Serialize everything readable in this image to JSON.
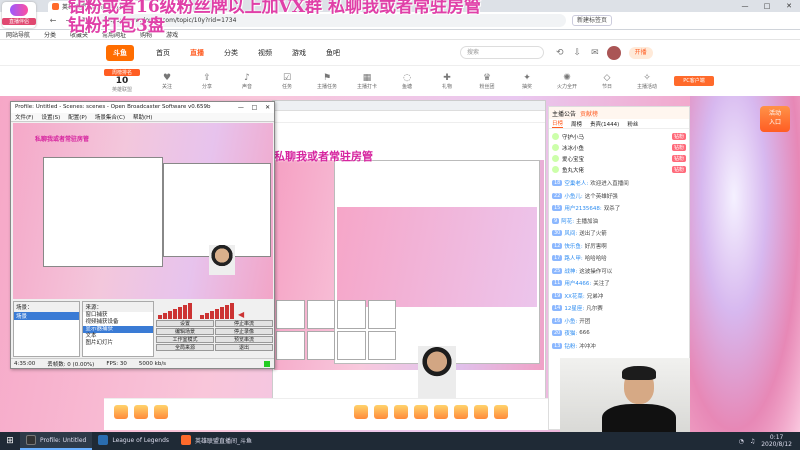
{
  "browser": {
    "tab_title": "英雄联盟直播间_斗鱼直播",
    "url": "https://www.douyu.com/topic/10y?rid=1734",
    "nav_back": "←",
    "nav_forward": "→",
    "nav_reload": "↻",
    "ext_label": "新建标签页",
    "window_min": "—",
    "window_max": "□",
    "window_close": "✕",
    "bookmarks": [
      "网站导航",
      "分类",
      "收藏夹",
      "常用网址",
      "购物",
      "游戏"
    ]
  },
  "overlay": {
    "app_label": "直播伴侣",
    "headline": "钻粉或者16级粉丝牌以上加VX群 私聊我或者常驻房管 钻粉打包3盘",
    "stream_headline": "私聊我或者常驻房管"
  },
  "site": {
    "logo": "斗鱼",
    "nav": [
      "首页",
      "直播",
      "分类",
      "视频",
      "游戏",
      "鱼吧"
    ],
    "nav_active": "直播",
    "search_placeholder": "搜索",
    "open_btn": "开播"
  },
  "room": {
    "rank_tag": "周榜排名",
    "rank_num": "10",
    "rank_sub": "英雄联盟",
    "tools": [
      "关注",
      "分享",
      "声音",
      "任务",
      "主播任务",
      "主播打卡",
      "鱼塘",
      "礼物",
      "粉丝团",
      "抽奖",
      "火力全开",
      "节日",
      "主播活动"
    ],
    "pc_btn": "PC客户端"
  },
  "chat": {
    "top_label": "主播公告",
    "top_tag": "贡献榜",
    "tabs": [
      "日榜",
      "周榜",
      "贵宾(1444)",
      "粉丝"
    ],
    "tab_active": "日榜",
    "ranks": [
      {
        "name": "守护小马",
        "badge": "钻粉"
      },
      {
        "name": "冰冰小鱼",
        "badge": "钻粉"
      },
      {
        "name": "爱心宝宝",
        "badge": "钻粉"
      },
      {
        "name": "鱼丸大佬",
        "badge": "钻粉"
      }
    ],
    "messages": [
      {
        "lv": "18",
        "user": "空巢老人:",
        "text": "欢迎进入直播间"
      },
      {
        "lv": "22",
        "user": "小鱼儿:",
        "text": "这个英雄好强"
      },
      {
        "lv": "15",
        "user": "用户2135648:",
        "text": "双杀了"
      },
      {
        "lv": "9",
        "user": "阿花:",
        "text": "主播加油"
      },
      {
        "lv": "30",
        "user": "风间:",
        "text": "送出了火箭"
      },
      {
        "lv": "12",
        "user": "快乐鱼:",
        "text": "好厉害啊"
      },
      {
        "lv": "17",
        "user": "路人甲:",
        "text": "哈哈哈哈"
      },
      {
        "lv": "25",
        "user": "战神:",
        "text": "这波操作可以"
      },
      {
        "lv": "11",
        "user": "用户4466:",
        "text": "关注了"
      },
      {
        "lv": "19",
        "user": "XX花菜:",
        "text": "兄弟冲"
      },
      {
        "lv": "14",
        "user": "12星座:",
        "text": "凡尔赛"
      },
      {
        "lv": "16",
        "user": "小鱼:",
        "text": "开团"
      },
      {
        "lv": "20",
        "user": "夜猫:",
        "text": "666"
      },
      {
        "lv": "13",
        "user": "钻粉:",
        "text": "冲冲冲"
      }
    ]
  },
  "obs": {
    "title": "Profile: Untitled - Scenes: scenes - Open Broadcaster Software v0.659b",
    "menu": [
      "文件(F)",
      "设置(S)",
      "配置(P)",
      "场景集合(C)",
      "帮助(H)"
    ],
    "scenes_label": "场景：",
    "scene_selected": "场景",
    "sources_label": "来源：",
    "sources": [
      "窗口捕获",
      "视频捕获设备",
      "显示器捕获",
      "文本",
      "图片幻灯片"
    ],
    "source_selected_index": 2,
    "buttons": [
      "设置",
      "停止串流",
      "编辑场景",
      "停止录像",
      "工作室模式",
      "预览串流",
      "全局来源",
      "退出"
    ],
    "status_time": "4:35:00",
    "status_fps": "FPS: 30",
    "status_kb": "5000 kb/s",
    "status_drop": "丢帧数: 0 (0.00%)"
  },
  "taskbar": {
    "start": "⊞",
    "tasks": [
      {
        "label": "Profile: Untitled",
        "color": "#333",
        "active": true
      },
      {
        "label": "League of Legends",
        "color": "#2a6db0",
        "active": false
      },
      {
        "label": "英雄联盟直播间_斗鱼",
        "color": "#ff6a2b",
        "active": false
      }
    ],
    "time": "0:17",
    "date": "2020/8/12"
  }
}
